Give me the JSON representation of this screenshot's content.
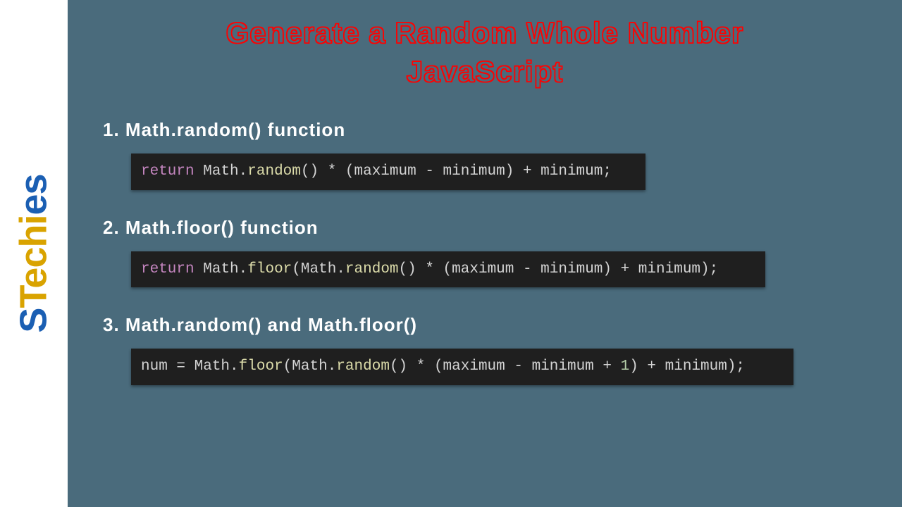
{
  "logo": {
    "s": "S",
    "t": "T",
    "ech": "ech",
    "i": "i",
    "es": "es"
  },
  "title": {
    "line1": "Generate a Random Whole Number",
    "line2": "JavaScript"
  },
  "sections": [
    {
      "heading": "1. Math.random() function",
      "code": [
        {
          "t": "return",
          "c": "k-return"
        },
        {
          "t": " ",
          "c": "k-punct"
        },
        {
          "t": "Math",
          "c": "k-object"
        },
        {
          "t": ".",
          "c": "k-punct"
        },
        {
          "t": "random",
          "c": "k-method"
        },
        {
          "t": "() * (maximum - minimum) + minimum;",
          "c": "k-punct"
        }
      ],
      "width": "w1"
    },
    {
      "heading": "2. Math.floor() function",
      "code": [
        {
          "t": "return",
          "c": "k-return"
        },
        {
          "t": " ",
          "c": "k-punct"
        },
        {
          "t": "Math",
          "c": "k-object"
        },
        {
          "t": ".",
          "c": "k-punct"
        },
        {
          "t": "floor",
          "c": "k-method"
        },
        {
          "t": "(",
          "c": "k-punct"
        },
        {
          "t": "Math",
          "c": "k-object"
        },
        {
          "t": ".",
          "c": "k-punct"
        },
        {
          "t": "random",
          "c": "k-method"
        },
        {
          "t": "() * (maximum - minimum) + minimum);",
          "c": "k-punct"
        }
      ],
      "width": "w2"
    },
    {
      "heading": "3. Math.random() and Math.floor()",
      "code": [
        {
          "t": "num = ",
          "c": "k-punct"
        },
        {
          "t": "Math",
          "c": "k-object"
        },
        {
          "t": ".",
          "c": "k-punct"
        },
        {
          "t": "floor",
          "c": "k-method"
        },
        {
          "t": "(",
          "c": "k-punct"
        },
        {
          "t": "Math",
          "c": "k-object"
        },
        {
          "t": ".",
          "c": "k-punct"
        },
        {
          "t": "random",
          "c": "k-method"
        },
        {
          "t": "() * (maximum - minimum + ",
          "c": "k-punct"
        },
        {
          "t": "1",
          "c": "k-num"
        },
        {
          "t": ") + minimum);",
          "c": "k-punct"
        }
      ],
      "width": "w3"
    }
  ]
}
